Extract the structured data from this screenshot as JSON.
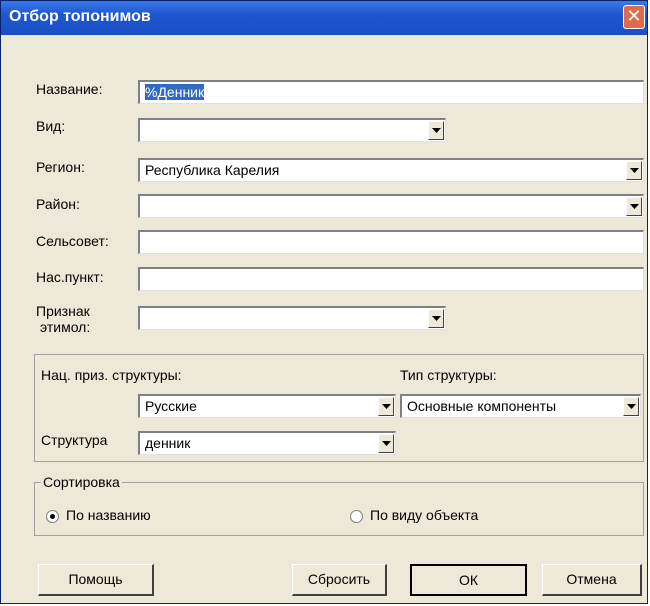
{
  "window": {
    "title": "Отбор топонимов",
    "close_glyph": "✕"
  },
  "fields": {
    "name": {
      "label": "Название:",
      "value": "%Денник"
    },
    "kind": {
      "label": "Вид:",
      "value": ""
    },
    "region": {
      "label": "Регион:",
      "value": "Республика Карелия"
    },
    "district": {
      "label": "Район:",
      "value": ""
    },
    "village_council": {
      "label": "Сельсовет:",
      "value": ""
    },
    "settlement": {
      "label": "Нас.пункт:",
      "value": ""
    },
    "etymology_sign": {
      "label_line1": "Признак",
      "label_line2": "этимол:",
      "value": ""
    }
  },
  "structure_group": {
    "nat_label": "Нац. приз. структуры:",
    "nat_value": "Русские",
    "type_label": "Тип структуры:",
    "type_value": "Основные компоненты",
    "structure_label": "Структура",
    "structure_value": "денник"
  },
  "sort_group": {
    "title": "Сортировка",
    "options": [
      {
        "label": "По названию",
        "selected": true
      },
      {
        "label": "По виду объекта",
        "selected": false
      }
    ]
  },
  "buttons": {
    "help": "Помощь",
    "reset": "Сбросить",
    "ok": "ОК",
    "cancel": "Отмена"
  }
}
